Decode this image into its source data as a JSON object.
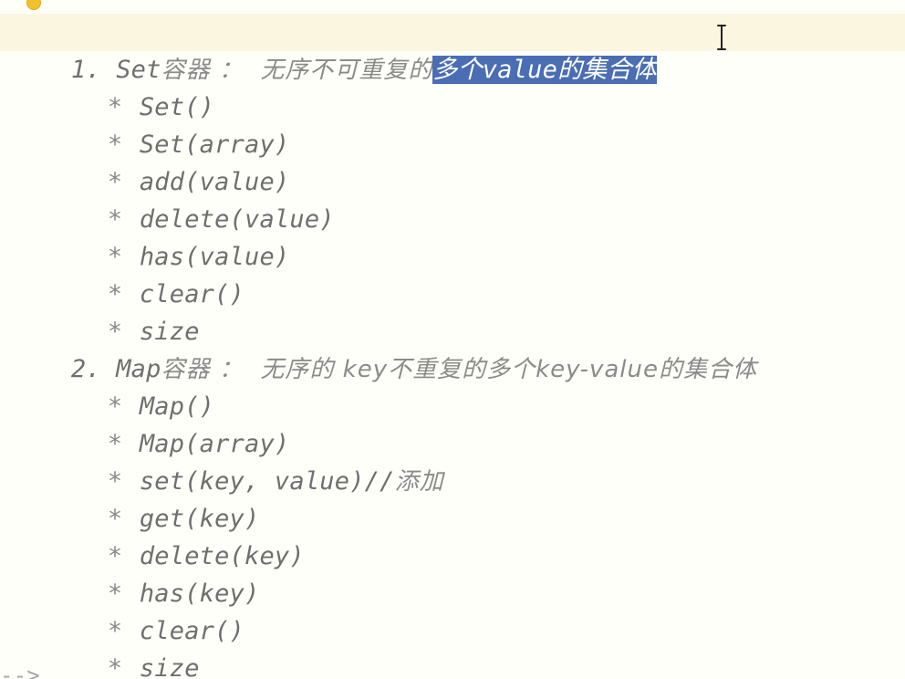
{
  "editor": {
    "lines": [
      {
        "marker": "1. ",
        "text": "Set",
        "cjk": "容器 ：  无序不可重复的",
        "selected": "多个value的集合体"
      },
      {
        "bullet": "* ",
        "text": "Set()"
      },
      {
        "bullet": "* ",
        "text": "Set(array)"
      },
      {
        "bullet": "* ",
        "text": "add(value)"
      },
      {
        "bullet": "* ",
        "text": "delete(value)"
      },
      {
        "bullet": "* ",
        "text": "has(value)"
      },
      {
        "bullet": "* ",
        "text": "clear()"
      },
      {
        "bullet": "* ",
        "text": "size"
      },
      {
        "marker": "2. ",
        "text": "Map",
        "cjk": "容器 ：  无序的 key不重复的多个key-value的集合体"
      },
      {
        "bullet": "* ",
        "text": "Map()"
      },
      {
        "bullet": "* ",
        "text": "Map(array)"
      },
      {
        "bullet": "* ",
        "text": "set(key, value)//",
        "cjk": "添加"
      },
      {
        "bullet": "* ",
        "text": "get(key)"
      },
      {
        "bullet": "* ",
        "text": "delete(key)"
      },
      {
        "bullet": "* ",
        "text": "has(key)"
      },
      {
        "bullet": "* ",
        "text": "clear()"
      },
      {
        "bullet": "* ",
        "text": "size"
      }
    ],
    "end_comment": "-->",
    "selection_color": "#4a6db3",
    "current_line_color": "#fbf6df",
    "bulb_icon": "lightbulb-icon",
    "cursor_icon": "text-cursor-icon"
  }
}
